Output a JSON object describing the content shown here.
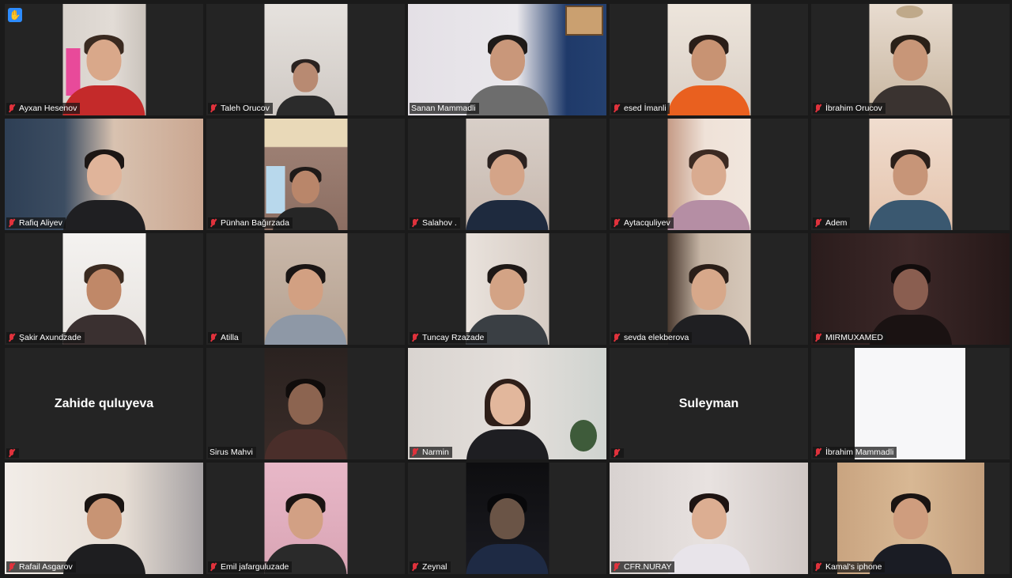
{
  "toolbar": {
    "raise_hand_icon": "raise-hand-icon",
    "raise_hand_color": "#2d8cff"
  },
  "speaking_color": "#d6e86a",
  "participants": [
    {
      "name": "Ayxan Hesenov",
      "muted": true
    },
    {
      "name": "Taleh Orucov",
      "muted": true
    },
    {
      "name": "Sanan Mammadli",
      "muted": false,
      "speaking": true
    },
    {
      "name": "esed İmanli",
      "muted": true
    },
    {
      "name": "İbrahim Orucov",
      "muted": true
    },
    {
      "name": "Rafiq Aliyev",
      "muted": true
    },
    {
      "name": "Pünhan Bağırzada",
      "muted": true
    },
    {
      "name": "Salahov .",
      "muted": true
    },
    {
      "name": "Aytacquliyev",
      "muted": true
    },
    {
      "name": "Adem",
      "muted": true
    },
    {
      "name": "Şakir Axundzade",
      "muted": true
    },
    {
      "name": "Atilla",
      "muted": true
    },
    {
      "name": "Tuncay Rzazade",
      "muted": true
    },
    {
      "name": "sevda elekberova",
      "muted": true
    },
    {
      "name": "MIRMUXAMED",
      "muted": true
    },
    {
      "name": "Zahide quluyeva",
      "muted": true,
      "video_off": true
    },
    {
      "name": "Sirus Mahvi",
      "muted": false
    },
    {
      "name": "Narmin",
      "muted": true
    },
    {
      "name": "Suleyman",
      "muted": true,
      "video_off": true
    },
    {
      "name": "İbrahim Mammadli",
      "muted": true
    },
    {
      "name": "Rafail Asgarov",
      "muted": true
    },
    {
      "name": "Emil jafarguluzade",
      "muted": true
    },
    {
      "name": "Zeynal",
      "muted": true
    },
    {
      "name": "CFR.NURAY",
      "muted": true
    },
    {
      "name": "Kamal's iphone",
      "muted": true
    }
  ]
}
